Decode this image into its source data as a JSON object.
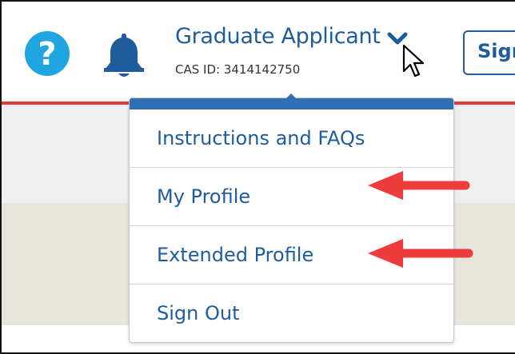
{
  "header": {
    "user_name": "Graduate Applicant",
    "cas_id": "CAS ID: 3414142750",
    "signin_label": "Sign",
    "icons": {
      "help": "help-icon",
      "notifications": "bell-icon",
      "dropdown": "chevron-down-icon",
      "cursor": "mouse-cursor-icon"
    }
  },
  "dropdown": {
    "items": [
      {
        "label": "Instructions and FAQs"
      },
      {
        "label": "My Profile"
      },
      {
        "label": "Extended Profile"
      },
      {
        "label": "Sign Out"
      }
    ]
  },
  "colors": {
    "accent_blue": "#1f5c9c",
    "help_cyan": "#1fa6e0",
    "header_red_line": "#e03a3e",
    "annotation_arrow": "#ee3b3b"
  }
}
